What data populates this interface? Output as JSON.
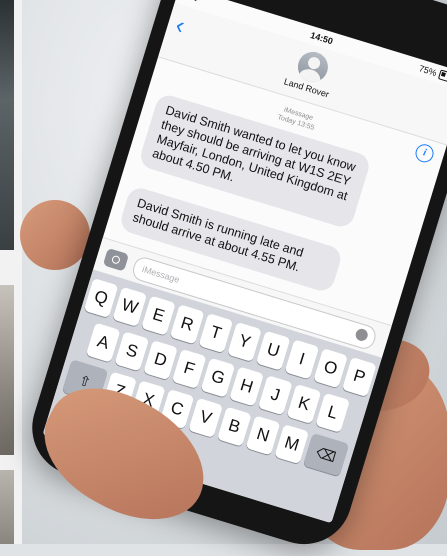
{
  "status": {
    "carrier": "•••• ",
    "time": "14:50",
    "battery": "75%"
  },
  "nav": {
    "contact_name": "Land Rover"
  },
  "thread": {
    "meta": "iMessage\nToday 13:55",
    "messages": [
      "David Smith wanted to let you know they should be arriving at W1S 2EY Mayfair, London, United Kingdom at about 4.50 PM.",
      "David Smith is running late and should arrive at about 4.55 PM."
    ]
  },
  "composer": {
    "placeholder": "iMessage"
  },
  "keyboard": {
    "row1": [
      "Q",
      "W",
      "E",
      "R",
      "T",
      "Y",
      "U",
      "I",
      "O",
      "P"
    ],
    "row2": [
      "A",
      "S",
      "D",
      "F",
      "G",
      "H",
      "J",
      "K",
      "L"
    ],
    "row3": [
      "⇧",
      "Z",
      "X",
      "C",
      "V",
      "B",
      "N",
      "M",
      "⌫"
    ]
  }
}
